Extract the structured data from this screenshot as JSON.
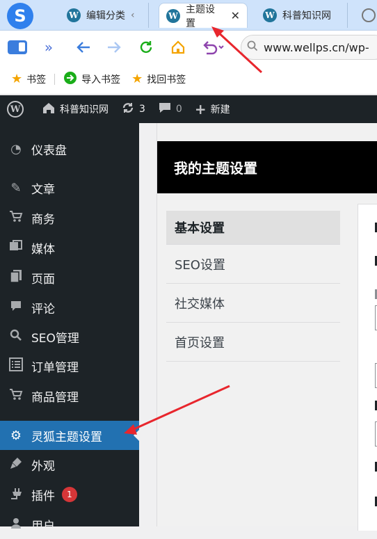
{
  "browser": {
    "logo_glyph": "S",
    "tabs": [
      {
        "label": "编辑分类",
        "suffix": "‹",
        "favicon": "W"
      },
      {
        "label": "主题设置",
        "close": "✕",
        "favicon": "W"
      },
      {
        "label": "科普知识网",
        "favicon": "W"
      }
    ],
    "url": "www.wellps.cn/wp-",
    "bookmarks": [
      {
        "label": "书签"
      },
      {
        "label": "导入书签"
      },
      {
        "label": "找回书签"
      }
    ],
    "colors": {
      "accent": "#2f80ed",
      "reload": "#1aad19",
      "home": "#f4a400",
      "undo": "#8e44ad"
    }
  },
  "adminbar": {
    "site_name": "科普知识网",
    "updates_count": "3",
    "comments_count": "0",
    "new_label": "新建"
  },
  "sidebar": {
    "items": [
      {
        "label": "仪表盘",
        "icon": "dashboard-icon"
      },
      {
        "label": "文章",
        "icon": "pin-icon"
      },
      {
        "label": "商务",
        "icon": "cart-icon"
      },
      {
        "label": "媒体",
        "icon": "media-icon"
      },
      {
        "label": "页面",
        "icon": "pages-icon"
      },
      {
        "label": "评论",
        "icon": "comment-icon"
      },
      {
        "label": "SEO管理",
        "icon": "search-icon"
      },
      {
        "label": "订单管理",
        "icon": "list-icon"
      },
      {
        "label": "商品管理",
        "icon": "cart-icon"
      },
      {
        "label": "灵狐主题设置",
        "icon": "gear-icon",
        "active": true
      },
      {
        "label": "外观",
        "icon": "brush-icon"
      },
      {
        "label": "插件",
        "icon": "plugin-icon",
        "badge": "1"
      },
      {
        "label": "用户",
        "icon": "user-icon"
      }
    ]
  },
  "panel": {
    "title": "我的主题设置",
    "tabs": [
      {
        "label": "基本设置",
        "active": true
      },
      {
        "label": "SEO设置"
      },
      {
        "label": "社交媒体"
      },
      {
        "label": "首页设置"
      }
    ]
  }
}
